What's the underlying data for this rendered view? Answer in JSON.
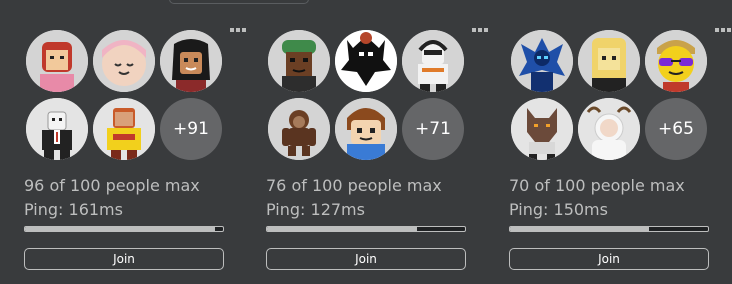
{
  "servers": [
    {
      "capacity_text": "96 of 100 people max",
      "ping_text": "Ping: 161ms",
      "extra_players": "+91",
      "fill_fraction": 0.96,
      "join_label": "Join",
      "avatar_icons": [
        "red-hair-girl-avatar-icon",
        "blonde-smiling-avatar-icon",
        "black-hair-avatar-icon",
        "suited-avatar-icon",
        "yellow-shirt-avatar-icon"
      ]
    },
    {
      "capacity_text": "76 of 100 people max",
      "ping_text": "Ping: 127ms",
      "extra_players": "+71",
      "fill_fraction": 0.76,
      "join_label": "Join",
      "avatar_icons": [
        "green-cap-avatar-icon",
        "black-creature-avatar-icon",
        "headphones-avatar-icon",
        "monkey-avatar-icon",
        "bacon-hair-avatar-icon"
      ]
    },
    {
      "capacity_text": "70 of 100 people max",
      "ping_text": "Ping: 150ms",
      "extra_players": "+65",
      "fill_fraction": 0.7,
      "join_label": "Join",
      "avatar_icons": [
        "blue-dragon-avatar-icon",
        "blonde-avatar-icon",
        "sunglasses-avatar-icon",
        "wolf-avatar-icon",
        "bunny-avatar-icon"
      ]
    }
  ]
}
